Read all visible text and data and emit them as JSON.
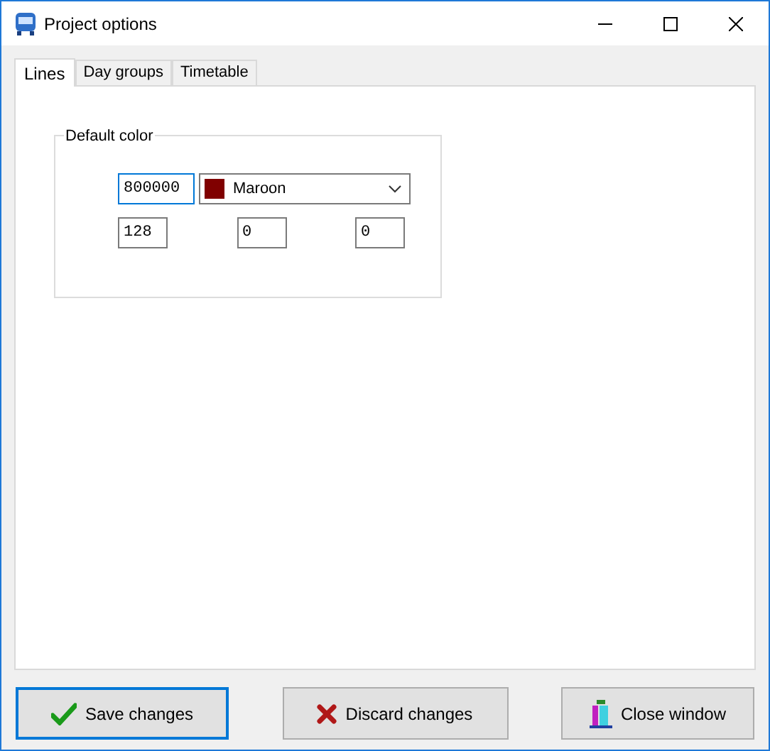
{
  "window": {
    "title": "Project options"
  },
  "tabs": [
    {
      "label": "Lines",
      "selected": true
    },
    {
      "label": "Day groups",
      "selected": false
    },
    {
      "label": "Timetable",
      "selected": false
    }
  ],
  "default_color": {
    "title": "Default color",
    "hex": {
      "value": "800000",
      "focused": true
    },
    "color_select": {
      "value": "Maroon",
      "color": "#800000"
    },
    "rgb": [
      {
        "value": "128"
      },
      {
        "value": "0"
      },
      {
        "value": "0"
      }
    ]
  },
  "buttons": [
    {
      "label": "Save changes",
      "kind": "save",
      "focused": true
    },
    {
      "label": "Discard changes",
      "kind": "discard",
      "focused": false
    },
    {
      "label": "Close window",
      "kind": "close",
      "focused": false
    }
  ]
}
